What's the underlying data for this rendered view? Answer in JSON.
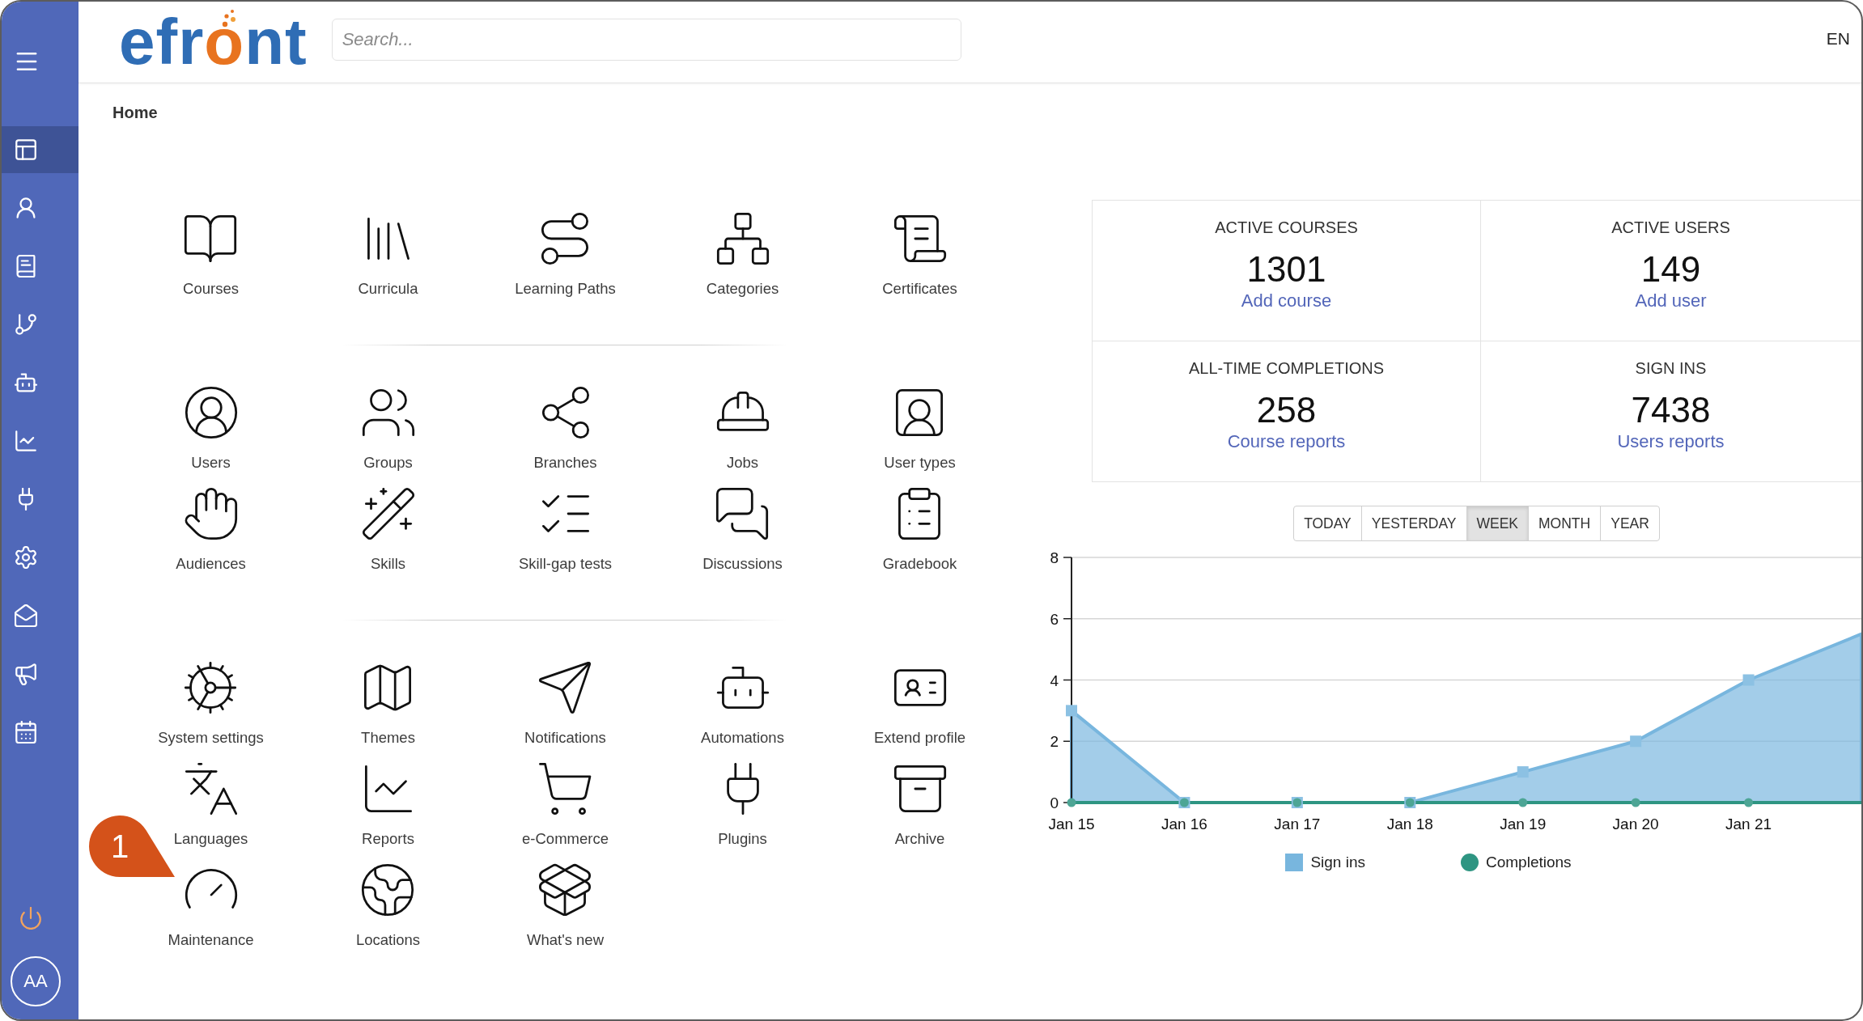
{
  "sidebar": {
    "items": [
      {
        "selected": true
      },
      {
        "selected": false
      },
      {
        "selected": false
      },
      {
        "selected": false
      },
      {
        "selected": false
      },
      {
        "selected": false
      },
      {
        "selected": false
      },
      {
        "selected": false
      },
      {
        "selected": false
      },
      {
        "selected": false
      },
      {
        "selected": false
      }
    ],
    "avatar": "AA"
  },
  "header": {
    "logo": "efront",
    "search": {
      "placeholder": "Search..."
    },
    "language": "EN"
  },
  "page_title": "Home",
  "modules": {
    "groups": [
      {
        "items": [
          {
            "label": "Courses"
          },
          {
            "label": "Curricula"
          },
          {
            "label": "Learning Paths"
          },
          {
            "label": "Categories"
          },
          {
            "label": "Certificates"
          }
        ]
      },
      {
        "items": [
          {
            "label": "Users"
          },
          {
            "label": "Groups"
          },
          {
            "label": "Branches"
          },
          {
            "label": "Jobs"
          },
          {
            "label": "User types"
          },
          {
            "label": "Audiences"
          },
          {
            "label": "Skills"
          },
          {
            "label": "Skill-gap tests"
          },
          {
            "label": "Discussions"
          },
          {
            "label": "Gradebook"
          }
        ]
      },
      {
        "items": [
          {
            "label": "System settings"
          },
          {
            "label": "Themes"
          },
          {
            "label": "Notifications"
          },
          {
            "label": "Automations"
          },
          {
            "label": "Extend profile"
          },
          {
            "label": "Languages"
          },
          {
            "label": "Reports"
          },
          {
            "label": "e-Commerce"
          },
          {
            "label": "Plugins"
          },
          {
            "label": "Archive"
          },
          {
            "label": "Maintenance"
          },
          {
            "label": "Locations"
          },
          {
            "label": "What's new"
          }
        ]
      }
    ]
  },
  "stats": [
    {
      "title": "ACTIVE COURSES",
      "value": "1301",
      "link": "Add course"
    },
    {
      "title": "ACTIVE USERS",
      "value": "149",
      "link": "Add user"
    },
    {
      "title": "ALL-TIME COMPLETIONS",
      "value": "258",
      "link": "Course reports"
    },
    {
      "title": "SIGN INS",
      "value": "7438",
      "link": "Users reports"
    }
  ],
  "activity_chart": {
    "range_buttons": [
      {
        "label": "TODAY",
        "selected": false
      },
      {
        "label": "YESTERDAY",
        "selected": false
      },
      {
        "label": "WEEK",
        "selected": true
      },
      {
        "label": "MONTH",
        "selected": false
      },
      {
        "label": "YEAR",
        "selected": false
      }
    ],
    "chart_data": {
      "type": "area",
      "categories": [
        "Jan 15",
        "Jan 16",
        "Jan 17",
        "Jan 18",
        "Jan 19",
        "Jan 20",
        "Jan 21",
        null
      ],
      "ylim": [
        0,
        8
      ],
      "yticks": [
        0,
        2,
        4,
        6,
        8
      ],
      "grid": true,
      "legend": "bottom",
      "series": [
        {
          "name": "Sign ins",
          "color": "#78b6de",
          "marker": "square",
          "values": [
            3,
            0,
            0,
            0,
            1,
            2,
            4,
            5.5
          ]
        },
        {
          "name": "Completions",
          "type": "line",
          "color": "#2e9582",
          "marker": "circle",
          "values": [
            0,
            0,
            0,
            0,
            0,
            0,
            0,
            0
          ]
        }
      ]
    }
  },
  "callout": {
    "text": "1"
  }
}
